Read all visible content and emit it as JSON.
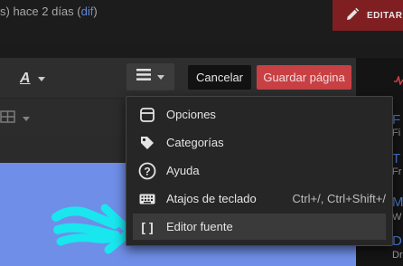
{
  "history": {
    "prefix": "s) hace 2 días (",
    "link": "dif",
    "suffix": ")"
  },
  "header": {
    "edit_label": "EDITAR"
  },
  "toolbar": {
    "text_style_letter": "A",
    "cancel_label": "Cancelar",
    "save_label": "Guardar página"
  },
  "menu": {
    "items": [
      {
        "icon": "options-icon",
        "label": "Opciones",
        "shortcut": ""
      },
      {
        "icon": "tag-icon",
        "label": "Categorías",
        "shortcut": ""
      },
      {
        "icon": "help-icon",
        "label": "Ayuda",
        "shortcut": ""
      },
      {
        "icon": "keyboard-icon",
        "label": "Atajos de teclado",
        "shortcut": "Ctrl+/, Ctrl+Shift+/"
      },
      {
        "icon": "brackets-icon",
        "label": "Editor fuente",
        "shortcut": ""
      }
    ],
    "brackets_glyph": "[ ]"
  },
  "sidebar": {
    "items": [
      {
        "title": "F",
        "sub": "Fi"
      },
      {
        "title": "T",
        "sub": "Fr"
      },
      {
        "title": "M",
        "sub": "W"
      },
      {
        "title": "D",
        "sub": "Dr"
      }
    ]
  },
  "colors": {
    "accent_red": "#c84044",
    "edit_red": "#7f1f22",
    "content_blue": "#6f8ee8",
    "annotation_cyan": "#19e6ee",
    "link_blue": "#4a79d8"
  }
}
